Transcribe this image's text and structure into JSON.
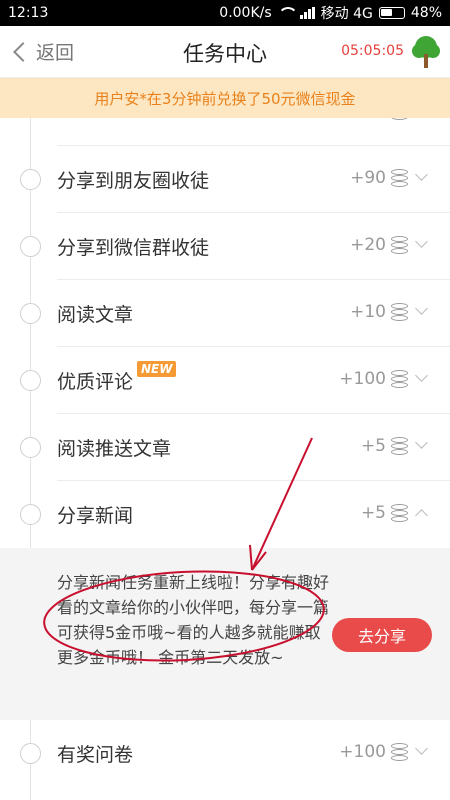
{
  "status_bar": {
    "time": "12:13",
    "speed": "0.00K/s",
    "carrier": "移动 4G",
    "battery": "48%"
  },
  "nav": {
    "back_label": "返回",
    "title": "任务中心",
    "timer": "05:05:05",
    "icon": "tree-icon"
  },
  "banner": {
    "text": "用户安*在3分钟前兑换了50元微信现金"
  },
  "tasks": [
    {
      "label": "分享到朋友圈收徒",
      "reward": "+90"
    },
    {
      "label": "分享到微信群收徒",
      "reward": "+20"
    },
    {
      "label": "阅读文章",
      "reward": "+10"
    },
    {
      "label": "优质评论",
      "reward": "+100",
      "badge": "NEW"
    },
    {
      "label": "阅读推送文章",
      "reward": "+5"
    },
    {
      "label": "分享新闻",
      "reward": "+5"
    },
    {
      "label": "有奖问卷",
      "reward": "+100"
    }
  ],
  "expanded": {
    "description": "分享新闻任务重新上线啦！分享有趣好看的文章给你的小伙伴吧，每分享一篇可获得5金币哦~看的人越多就能赚取更多金币哦！ 金币第二天发放~",
    "button_label": "去分享"
  },
  "colors": {
    "accent_red": "#e94b4b",
    "banner_bg": "#fde7c3",
    "banner_text": "#e8811a",
    "annotation_red": "#c8102e"
  }
}
